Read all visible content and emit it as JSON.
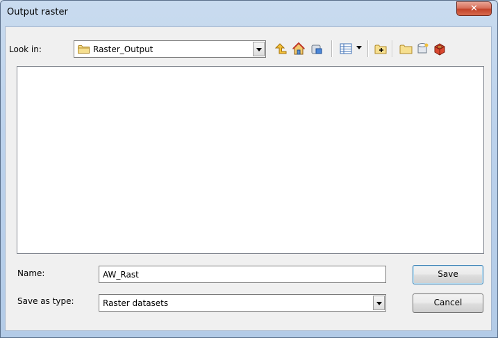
{
  "window": {
    "title": "Output raster",
    "close_symbol": "✕"
  },
  "toolbar": {
    "look_in_label": "Look in:",
    "look_in_value": "Raster_Output",
    "icons": [
      "up-one-level-icon",
      "home-icon",
      "catalog-connect-icon",
      "view-menu-icon",
      "new-folder-icon",
      "folder-connect-icon",
      "new-geodatabase-icon",
      "toolbox-icon"
    ]
  },
  "file_list": {
    "items": []
  },
  "form": {
    "name_label": "Name:",
    "name_value": "AW_Rast",
    "type_label": "Save as type:",
    "type_value": "Raster datasets"
  },
  "buttons": {
    "save": "Save",
    "cancel": "Cancel"
  },
  "colors": {
    "close_button": "#c2432a",
    "frame": "#bcd2ec",
    "client": "#f0f0f0"
  }
}
